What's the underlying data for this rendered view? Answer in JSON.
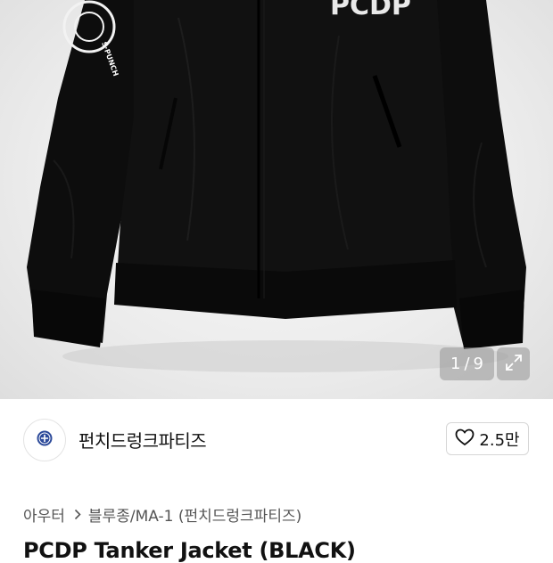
{
  "hero": {
    "graphic_text": "PCDP",
    "patch_text": "S·PUNCH",
    "pager": {
      "current": "1",
      "separator": "/",
      "total": "9"
    },
    "expand_icon": "expand-arrows-icon"
  },
  "brand": {
    "name": "펀치드렁크파티즈",
    "avatar_icon": "brand-logo-icon",
    "like_icon": "heart-outline-icon",
    "like_count": "2.5만"
  },
  "breadcrumb": {
    "items": [
      "아우터",
      "블루종/MA-1 (펀치드렁크파티즈)"
    ],
    "separator_icon": "chevron-right-icon"
  },
  "product": {
    "title": "PCDP Tanker Jacket (BLACK)"
  }
}
